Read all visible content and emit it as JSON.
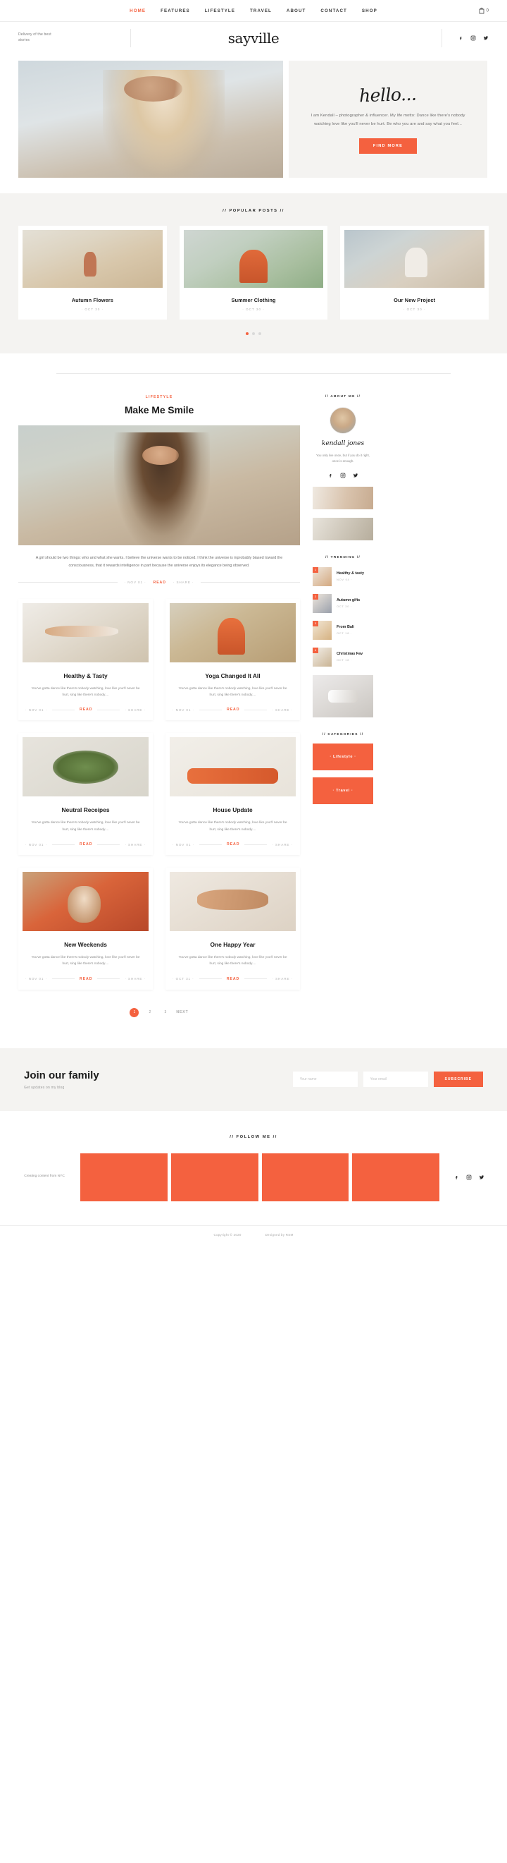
{
  "brand": {
    "name": "sayville",
    "tagline": "Delivery of the best stories"
  },
  "nav": {
    "items": [
      {
        "label": "HOME",
        "active": true
      },
      {
        "label": "FEATURES",
        "active": false
      },
      {
        "label": "LIFESTYLE",
        "active": false
      },
      {
        "label": "TRAVEL",
        "active": false
      },
      {
        "label": "ABOUT",
        "active": false
      },
      {
        "label": "CONTACT",
        "active": false
      },
      {
        "label": "SHOP",
        "active": false
      }
    ],
    "cart_count": "0"
  },
  "hero": {
    "greeting": "hello...",
    "paragraph": "I am Kendall – photographer & influencer. My life motto: Dance like there's nobody watching love like you'll never be hurt. Be who you are and say what you feel...",
    "cta": "FIND MORE"
  },
  "popular": {
    "label": "// POPULAR POSTS //",
    "posts": [
      {
        "title": "Autumn Flowers",
        "date": "· OCT 30 ·"
      },
      {
        "title": "Summer Clothing",
        "date": "· OCT 30 ·"
      },
      {
        "title": "Our New Project",
        "date": "· OCT 30 ·"
      }
    ]
  },
  "featured": {
    "category": "LIFESTYLE",
    "title": "Make Me Smile",
    "excerpt": "A girl should be two things: who and what she wants. I believe the universe wants to be noticed. I think the universe is inprobably biased toward the consciousness, that it rewards intelligence in part because the universe enjoys its elegance being observed.",
    "date": "· NOV 01 ·",
    "read": "READ",
    "share": "· SHARE ·"
  },
  "grid": {
    "cards": [
      {
        "title": "Healthy & Tasty",
        "excerpt": "You've gotta dance like there's nobody watching, love like you'll never be hurt, sing like there's nobody....",
        "date": "· NOV 01 ·",
        "read": "READ",
        "share": "· SHARE ·"
      },
      {
        "title": "Yoga Changed It All",
        "excerpt": "You've gotta dance like there's nobody watching, love like you'll never be hurt, sing like there's nobody....",
        "date": "· NOV 01 ·",
        "read": "READ",
        "share": "· SHARE ·"
      },
      {
        "title": "Neutral Receipes",
        "excerpt": "You've gotta dance like there's nobody watching, love like you'll never be hurt, sing like there's nobody....",
        "date": "· NOV 01 ·",
        "read": "READ",
        "share": "· SHARE ·"
      },
      {
        "title": "House Update",
        "excerpt": "You've gotta dance like there's nobody watching, love like you'll never be hurt, sing like there's nobody....",
        "date": "· NOV 01 ·",
        "read": "READ",
        "share": "· SHARE ·"
      },
      {
        "title": "New Weekends",
        "excerpt": "You've gotta dance like there's nobody watching, love like you'll never be hurt, sing like there's nobody....",
        "date": "· NOV 01 ·",
        "read": "READ",
        "share": "· SHARE ·"
      },
      {
        "title": "One Happy Year",
        "excerpt": "You've gotta dance like there's nobody watching, love like you'll never be hurt, sing like there's nobody....",
        "date": "· OCT 31 ·",
        "read": "READ",
        "share": "· SHARE ·"
      }
    ]
  },
  "pagination": {
    "pages": [
      "1",
      "2",
      "3"
    ],
    "current": "1",
    "next": "NEXT"
  },
  "sidebar": {
    "about_label": "// ABOUT ME //",
    "signature": "kendall jones",
    "about_text": "You only live once, but if you do it right, once is enough.",
    "trending_label": "// TRENDING //",
    "trending": [
      {
        "num": "1",
        "title": "Healthy & tasty",
        "date": "NOV 04 ·"
      },
      {
        "num": "2",
        "title": "Autumn gifts",
        "date": "OCT 30 ·"
      },
      {
        "num": "3",
        "title": "From Bali",
        "date": "OCT 18 ·"
      },
      {
        "num": "4",
        "title": "Christmas Fav",
        "date": "OCT 18 ·"
      }
    ],
    "categories_label": "// CATEGORIES //",
    "categories": [
      {
        "label": "· Lifestyle ·"
      },
      {
        "label": "· Travel ·"
      }
    ]
  },
  "newsletter": {
    "heading": "Join our family",
    "subheading": "Get updates on my blog",
    "name_placeholder": "Your name",
    "email_placeholder": "Your email",
    "button": "SUBSCRIBE"
  },
  "follow": {
    "label": "// FOLLOW ME //",
    "side_text": "Creating content from NYC"
  },
  "footer": {
    "copyright": "Copyright © 2020",
    "credit": "Designed by RSM"
  },
  "colors": {
    "accent": "#f4613f",
    "text": "#1c1c1c",
    "muted": "#8d8d8d",
    "panel": "#f4f3f1"
  }
}
